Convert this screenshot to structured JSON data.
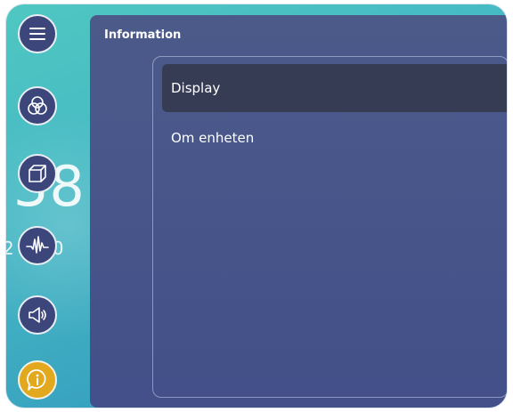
{
  "panel": {
    "title": "Information"
  },
  "menu": {
    "items": [
      {
        "label": "Display",
        "selected": true
      },
      {
        "label": "Om enheten",
        "selected": false
      }
    ]
  },
  "sidebar": {
    "buttons": [
      {
        "icon": "hamburger-icon",
        "active": false
      },
      {
        "icon": "color-circles-icon",
        "active": false
      },
      {
        "icon": "cube-icon",
        "active": false
      },
      {
        "icon": "waveform-icon",
        "active": false
      },
      {
        "icon": "speaker-icon",
        "active": false
      },
      {
        "icon": "info-icon",
        "active": true
      }
    ]
  },
  "background": {
    "clock_fragment": ":38",
    "date_fragment": "2 20"
  },
  "colors": {
    "panel": "#47558a",
    "selected_row": "#373c55",
    "active_button": "#e2a91e",
    "screen_teal": "#46b9c4"
  }
}
